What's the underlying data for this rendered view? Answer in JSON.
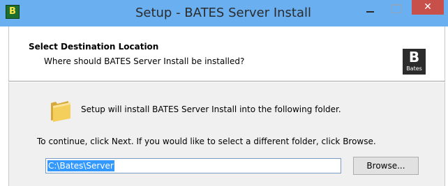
{
  "window": {
    "title": "Setup - BATES Server Install",
    "app_icon": "bates-app-icon",
    "app_icon_glyph": "B",
    "close_glyph": "✕",
    "titlebar_color": "#6aaff0",
    "close_color": "#c7504b"
  },
  "header": {
    "title": "Select Destination Location",
    "subtitle": "Where should BATES Server Install be installed?",
    "logo": {
      "letter": "B",
      "word": "Bates"
    }
  },
  "body": {
    "folder_icon": "folder-icon",
    "install_text": "Setup will install BATES Server Install into the following folder.",
    "continue_text": "To continue, click Next. If you would like to select a different folder, click Browse.",
    "path_value": "C:\\Bates\\Server",
    "browse_label": "Browse..."
  }
}
